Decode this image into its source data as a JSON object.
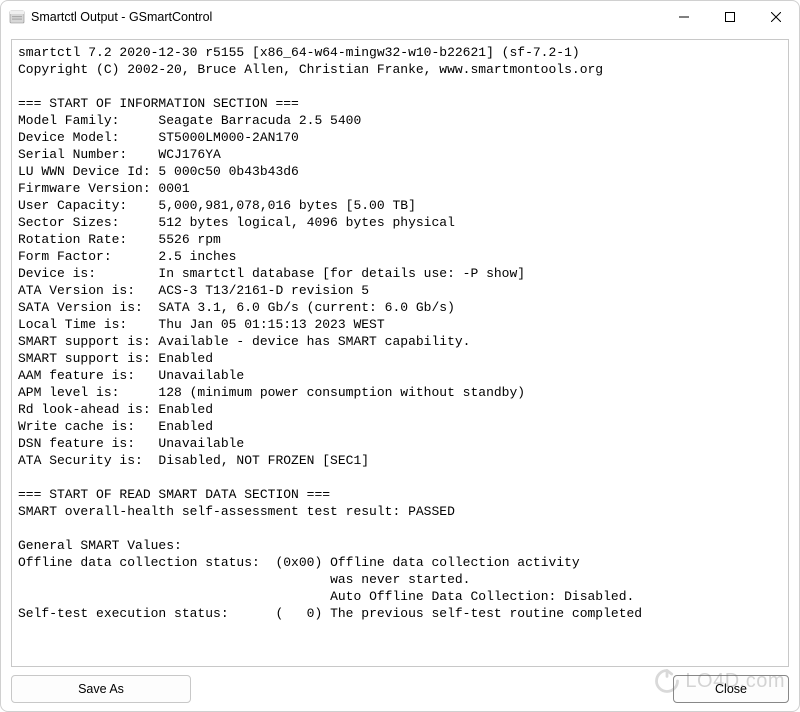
{
  "window": {
    "title": "Smartctl Output - GSmartControl"
  },
  "output": {
    "header_line": "smartctl 7.2 2020-12-30 r5155 [x86_64-w64-mingw32-w10-b22621] (sf-7.2-1)",
    "copyright_line": "Copyright (C) 2002-20, Bruce Allen, Christian Franke, www.smartmontools.org",
    "info_section_header": "=== START OF INFORMATION SECTION ===",
    "info": {
      "model_family": {
        "label": "Model Family:     ",
        "value": "Seagate Barracuda 2.5 5400"
      },
      "device_model": {
        "label": "Device Model:     ",
        "value": "ST5000LM000-2AN170"
      },
      "serial_number": {
        "label": "Serial Number:    ",
        "value": "WCJ176YA"
      },
      "lu_wwn": {
        "label": "LU WWN Device Id: ",
        "value": "5 000c50 0b43b43d6"
      },
      "firmware": {
        "label": "Firmware Version: ",
        "value": "0001"
      },
      "user_capacity": {
        "label": "User Capacity:    ",
        "value": "5,000,981,078,016 bytes [5.00 TB]"
      },
      "sector_sizes": {
        "label": "Sector Sizes:     ",
        "value": "512 bytes logical, 4096 bytes physical"
      },
      "rotation_rate": {
        "label": "Rotation Rate:    ",
        "value": "5526 rpm"
      },
      "form_factor": {
        "label": "Form Factor:      ",
        "value": "2.5 inches"
      },
      "device_is": {
        "label": "Device is:        ",
        "value": "In smartctl database [for details use: -P show]"
      },
      "ata_version": {
        "label": "ATA Version is:   ",
        "value": "ACS-3 T13/2161-D revision 5"
      },
      "sata_version": {
        "label": "SATA Version is:  ",
        "value": "SATA 3.1, 6.0 Gb/s (current: 6.0 Gb/s)"
      },
      "local_time": {
        "label": "Local Time is:    ",
        "value": "Thu Jan 05 01:15:13 2023 WEST"
      },
      "smart_avail": {
        "label": "SMART support is: ",
        "value": "Available - device has SMART capability."
      },
      "smart_enabled": {
        "label": "SMART support is: ",
        "value": "Enabled"
      },
      "aam": {
        "label": "AAM feature is:   ",
        "value": "Unavailable"
      },
      "apm": {
        "label": "APM level is:     ",
        "value": "128 (minimum power consumption without standby)"
      },
      "rd_lookahead": {
        "label": "Rd look-ahead is: ",
        "value": "Enabled"
      },
      "write_cache": {
        "label": "Write cache is:   ",
        "value": "Enabled"
      },
      "dsn": {
        "label": "DSN feature is:   ",
        "value": "Unavailable"
      },
      "ata_security": {
        "label": "ATA Security is:  ",
        "value": "Disabled, NOT FROZEN [SEC1]"
      }
    },
    "smart_section_header": "=== START OF READ SMART DATA SECTION ===",
    "smart_overall": "SMART overall-health self-assessment test result: PASSED",
    "general_values_header": "General SMART Values:",
    "offline_status_l1": "Offline data collection status:  (0x00)\tOffline data collection activity",
    "offline_status_l2": "\t\t\t\t\twas never started.",
    "offline_status_l3": "\t\t\t\t\tAuto Offline Data Collection: Disabled.",
    "selftest_partial": "Self-test execution status:      (   0)\tThe previous self-test routine completed"
  },
  "buttons": {
    "save_as": "Save As",
    "close": "Close"
  },
  "watermark": {
    "text": "LO4D.com"
  }
}
